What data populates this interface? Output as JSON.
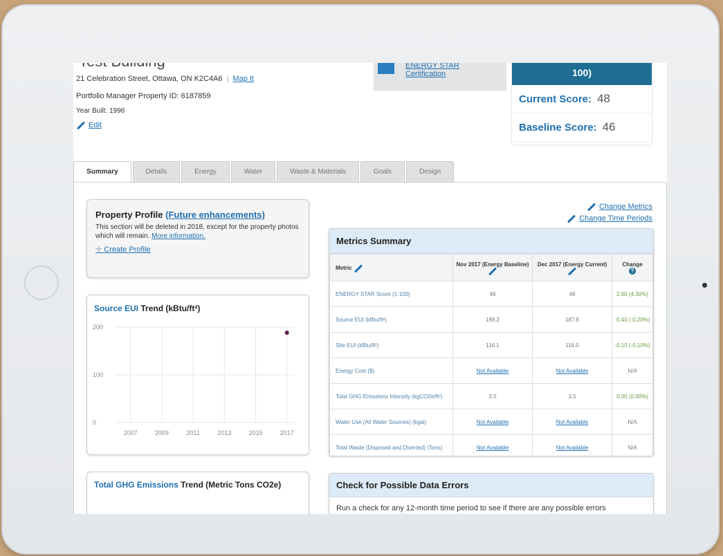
{
  "property": {
    "title_partial": "Test Building",
    "address": "21 Celebration Street, Ottawa, ON K2C4A6",
    "map_link": "Map It",
    "pm_id": "Portfolio Manager Property ID: 6187859",
    "year_built": "Year Built: 1996",
    "edit": "Edit"
  },
  "energy_star": {
    "line1": "ENERGY STAR",
    "line2": "Certification"
  },
  "score": {
    "header": "100)",
    "current_label": "Current Score:",
    "current_value": "48",
    "baseline_label": "Baseline Score:",
    "baseline_value": "46"
  },
  "tabs": [
    "Summary",
    "Details",
    "Energy",
    "Water",
    "Waste & Materials",
    "Goals",
    "Design"
  ],
  "profile": {
    "title": "Property Profile",
    "link": "(Future enhancements)",
    "text": "This section will be deleted in 2018, except for the property photos which will remain.",
    "more": "More information.",
    "create": "Create Profile"
  },
  "eui_chart": {
    "title_blue": "Source EUI",
    "title_rest": "Trend (kBtu/ft²)"
  },
  "chart_data": {
    "type": "scatter",
    "title": "Source EUI Trend (kBtu/ft²)",
    "x": [
      2017
    ],
    "y": [
      188.2
    ],
    "xticks": [
      "2007",
      "2009",
      "2011",
      "2013",
      "2015",
      "2017"
    ],
    "yticks": [
      "0",
      "100",
      "200"
    ],
    "xlim": [
      2006,
      2017.5
    ],
    "ylim": [
      0,
      200
    ],
    "grid": true,
    "point_color": "#5a1a4a"
  },
  "ghg": {
    "title_blue": "Total GHG Emissions",
    "title_rest": "Trend (Metric Tons CO2e)"
  },
  "change_links": {
    "metrics": "Change Metrics",
    "periods": "Change Time Periods"
  },
  "metrics": {
    "title": "Metrics Summary",
    "headers": [
      "Metric",
      "Nov 2017 (Energy Baseline)",
      "Dec 2017 (Energy Current)",
      "Change"
    ],
    "rows": [
      {
        "metric": "ENERGY STAR Score (1-100)",
        "base": "46",
        "cur": "48",
        "change": "2.00 (4.30%)"
      },
      {
        "metric": "Source EUI (kBtu/ft²)",
        "base": "188.2",
        "cur": "187.8",
        "change": "-0.40 (-0.20%)"
      },
      {
        "metric": "Site EUI (kBtu/ft²)",
        "base": "116.1",
        "cur": "116.0",
        "change": "-0.10 (-0.10%)"
      },
      {
        "metric": "Energy Cost ($)",
        "base": "Not Available",
        "cur": "Not Available",
        "change": "N/A"
      },
      {
        "metric": "Total GHG Emissions Intensity (kgCO2e/ft²)",
        "base": "3.5",
        "cur": "3.5",
        "change": "0.00 (0.00%)"
      },
      {
        "metric": "Water Use (All Water Sources) (kgal)",
        "base": "Not Available",
        "cur": "Not Available",
        "change": "N/A"
      },
      {
        "metric": "Total Waste (Disposed and Diverted) (Tons)",
        "base": "Not Available",
        "cur": "Not Available",
        "change": "N/A"
      }
    ]
  },
  "data_errors": {
    "title": "Check for Possible Data Errors",
    "text": "Run a check for any 12-month time period to see if there are any possible errors"
  }
}
